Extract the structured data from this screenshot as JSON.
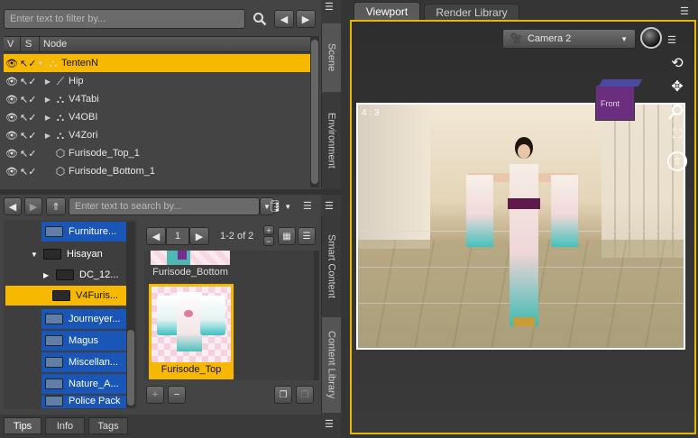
{
  "scene_pane": {
    "filter_placeholder": "Enter text to filter by...",
    "columns": {
      "v": "V",
      "s": "S",
      "node": "Node"
    },
    "nodes": [
      {
        "label": "TentenN",
        "selected": true,
        "expandable": true,
        "expanded": true,
        "icon": "figure-icon"
      },
      {
        "label": "Hip",
        "selected": false,
        "expandable": true,
        "expanded": false,
        "icon": "bone-icon"
      },
      {
        "label": "V4Tabi",
        "selected": false,
        "expandable": true,
        "expanded": false,
        "icon": "figure-icon"
      },
      {
        "label": "V4OBI",
        "selected": false,
        "expandable": true,
        "expanded": false,
        "icon": "figure-icon"
      },
      {
        "label": "V4Zori",
        "selected": false,
        "expandable": true,
        "expanded": false,
        "icon": "figure-icon"
      },
      {
        "label": "Furisode_Top_1",
        "selected": false,
        "expandable": false,
        "expanded": false,
        "icon": "prop-icon"
      },
      {
        "label": "Furisode_Bottom_1",
        "selected": false,
        "expandable": false,
        "expanded": false,
        "icon": "prop-icon"
      }
    ],
    "side_tabs": [
      "Scene",
      "Environment"
    ]
  },
  "content_pane": {
    "search_placeholder": "Enter text to search by...",
    "folders": [
      {
        "label": "Furniture...",
        "style": "blue",
        "indent": 0,
        "expander": ""
      },
      {
        "label": "Hisayan",
        "style": "plain",
        "indent": 0,
        "expander": "▼"
      },
      {
        "label": "DC_12...",
        "style": "plain",
        "indent": 1,
        "expander": "▶"
      },
      {
        "label": "V4Furis...",
        "style": "selected",
        "indent": 2,
        "expander": ""
      },
      {
        "label": "Journeyer...",
        "style": "blue",
        "indent": 0,
        "expander": ""
      },
      {
        "label": "Magus",
        "style": "blue",
        "indent": 0,
        "expander": ""
      },
      {
        "label": "Miscellan...",
        "style": "blue",
        "indent": 0,
        "expander": ""
      },
      {
        "label": "Nature_A...",
        "style": "blue",
        "indent": 0,
        "expander": ""
      },
      {
        "label": "Police Pack",
        "style": "blue",
        "indent": 0,
        "expander": ""
      }
    ],
    "page_number": "1",
    "page_count": "1-2 of 2",
    "items": [
      {
        "label": "Furisode_Bottom",
        "selected": false
      },
      {
        "label": "Furisode_Top",
        "selected": true
      }
    ],
    "side_tabs": [
      "Smart Content",
      "Content Library"
    ]
  },
  "bottom_tabs": [
    "Tips",
    "Info",
    "Tags"
  ],
  "viewport": {
    "tabs": [
      "Viewport",
      "Render Library"
    ],
    "camera": "Camera 2",
    "aspect": "4 : 3",
    "view_cube_label": "Front",
    "accent": "#e8b800"
  }
}
